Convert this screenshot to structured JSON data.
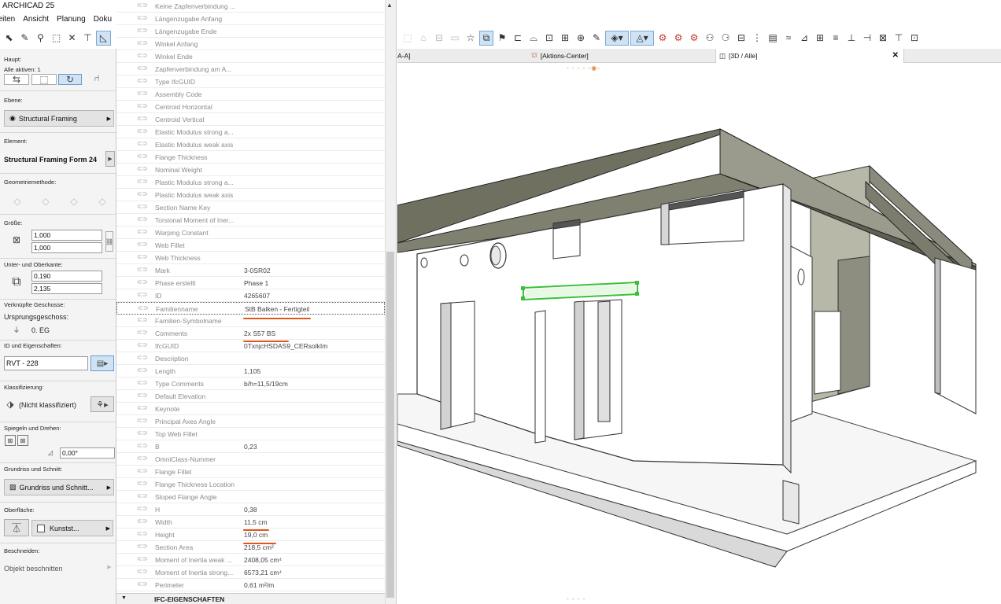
{
  "app": {
    "title": "ARCHICAD 25"
  },
  "menu": [
    "beiten",
    "Ansicht",
    "Planung",
    "Doku"
  ],
  "infobox": {
    "haupt_label": "Haupt:",
    "alle_aktiven": "Alle aktiven: 1",
    "ebene_label": "Ebene:",
    "ebene_value": "Structural Framing",
    "element_label": "Element:",
    "element_value": "Structural Framing Form 24",
    "geometrie_label": "Geometriemethode:",
    "groesse_label": "Größe:",
    "groesse_1": "1,000",
    "groesse_2": "1,000",
    "unter_ober_label": "Unter- und Oberkante:",
    "unter": "0,190",
    "ober": "2,135",
    "verknuepfte_label": "Verknüpfte Geschosse:",
    "ursprung_label": "Ursprungsgeschoss:",
    "ursprung_value": "0. EG",
    "id_label": "ID und Eigenschaften:",
    "id_value": "RVT - 228",
    "klass_label": "Klassifizierung:",
    "klass_value": "(Nicht klassifiziert)",
    "spiegeln_label": "Spiegeln und Drehen:",
    "angle_value": "0,00°",
    "grundriss_label": "Grundriss und Schnitt:",
    "grundriss_value": "Grundriss und Schnitt...",
    "oberflaeche_label": "Oberfläche:",
    "oberflaeche_value": "Kunstst...",
    "beschneiden_label": "Beschneiden:",
    "beschneiden_value": "Objekt beschnitten"
  },
  "properties": [
    {
      "name": "Keine Zapfenverbindung ...",
      "value": ""
    },
    {
      "name": "Längenzugabe Anfang",
      "value": ""
    },
    {
      "name": "Längenzugabe Ende",
      "value": ""
    },
    {
      "name": "Winkel Anfang",
      "value": ""
    },
    {
      "name": "Winkel Ende",
      "value": ""
    },
    {
      "name": "Zapfenverbindung am A...",
      "value": ""
    },
    {
      "name": "Type IfcGUID",
      "value": ""
    },
    {
      "name": "Assembly Code",
      "value": ""
    },
    {
      "name": "Centroid Horizontal",
      "value": ""
    },
    {
      "name": "Centroid Vertical",
      "value": ""
    },
    {
      "name": "Elastic Modulus strong a...",
      "value": ""
    },
    {
      "name": "Elastic Modulus weak axis",
      "value": ""
    },
    {
      "name": "Flange Thickness",
      "value": ""
    },
    {
      "name": "Nominal Weight",
      "value": ""
    },
    {
      "name": "Plastic Modulus strong a...",
      "value": ""
    },
    {
      "name": "Plastic Modulus weak axis",
      "value": ""
    },
    {
      "name": "Section Name Key",
      "value": ""
    },
    {
      "name": "Torsional Moment of Iner...",
      "value": ""
    },
    {
      "name": "Warping Constant",
      "value": ""
    },
    {
      "name": "Web Fillet",
      "value": ""
    },
    {
      "name": "Web Thickness",
      "value": ""
    },
    {
      "name": "Mark",
      "value": "3-0SR02"
    },
    {
      "name": "Phase erstellt",
      "value": "Phase 1"
    },
    {
      "name": "ID",
      "value": "4265607"
    },
    {
      "name": "Familienname",
      "value": "StB Balken - Fertigteil"
    },
    {
      "name": "Familien-Symbolname",
      "value": ""
    },
    {
      "name": "Comments",
      "value": "2x S57 BS"
    },
    {
      "name": "IfcGUID",
      "value": "0TxnjcHSDAS9_CERsolkIm"
    },
    {
      "name": "Description",
      "value": ""
    },
    {
      "name": "Length",
      "value": "1,105"
    },
    {
      "name": "Type Comments",
      "value": "b/h=11,5/19cm"
    },
    {
      "name": "Default Elevation",
      "value": ""
    },
    {
      "name": "Keynote",
      "value": ""
    },
    {
      "name": "Principal Axes Angle",
      "value": ""
    },
    {
      "name": "Top Web Fillet",
      "value": ""
    },
    {
      "name": "B",
      "value": "0,23"
    },
    {
      "name": "OmniClass-Nummer",
      "value": ""
    },
    {
      "name": "Flange Fillet",
      "value": ""
    },
    {
      "name": "Flange Thickness Location",
      "value": ""
    },
    {
      "name": "Sloped Flange Angle",
      "value": ""
    },
    {
      "name": "H",
      "value": "0,38"
    },
    {
      "name": "Width",
      "value": "11,5 cm"
    },
    {
      "name": "Height",
      "value": "19,0 cm"
    },
    {
      "name": "Section Area",
      "value": "218,5 cm²"
    },
    {
      "name": "Moment of Inertia weak ...",
      "value": "2408,05 cm⁴"
    },
    {
      "name": "Moment of Inertia strong...",
      "value": "6573,21 cm⁴"
    },
    {
      "name": "Perimeter",
      "value": "0,61 m²/m"
    }
  ],
  "ifc_section": "IFC-EIGENSCHAFTEN",
  "tabs": {
    "tab1": "A-A]",
    "tab2": "[Aktions-Center]",
    "tab3": "[3D / Alle]"
  },
  "colors": {
    "accent_underline": "#e0561c",
    "selection_green": "#3cbf3c",
    "wall_dark": "#6f7060"
  }
}
